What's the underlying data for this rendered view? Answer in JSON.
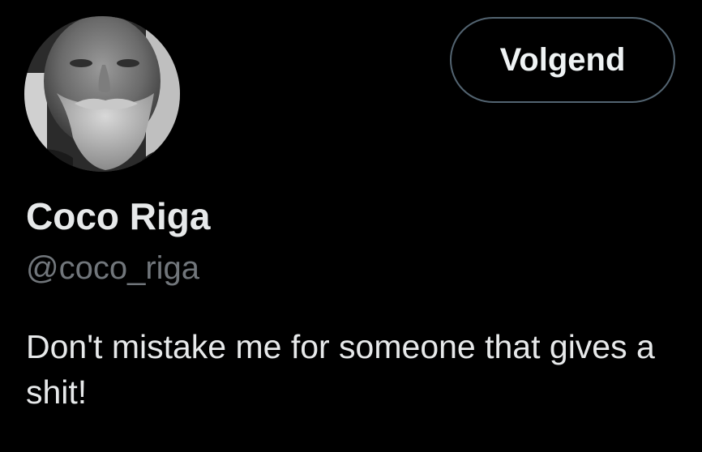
{
  "profile": {
    "avatar_description": "profile-photo",
    "display_name": "Coco Riga",
    "handle": "@coco_riga",
    "bio": "Don't mistake me for someone that gives a shit!"
  },
  "actions": {
    "follow_label": "Volgend"
  },
  "colors": {
    "background": "#000000",
    "primary_text": "#e7e9ea",
    "secondary_text": "#71767b",
    "button_border": "#536471"
  }
}
